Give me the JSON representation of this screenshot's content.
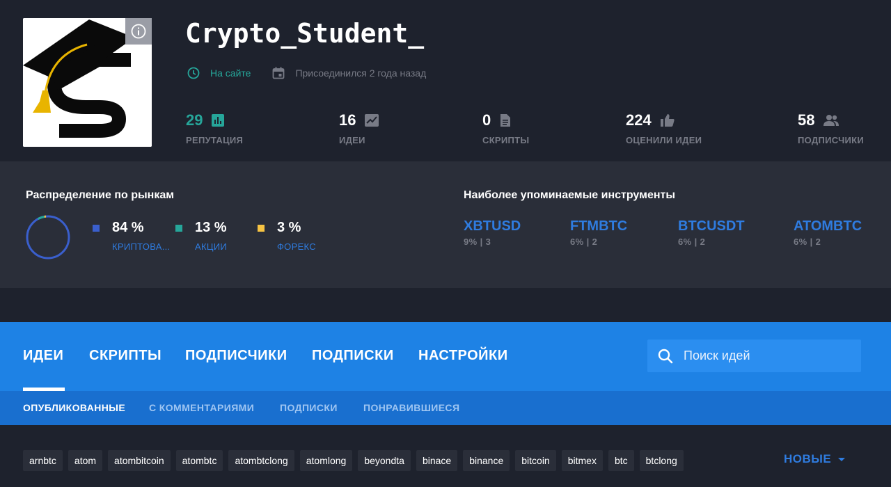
{
  "profile": {
    "username": "Crypto_Student_",
    "status": "На сайте",
    "joined": "Присоединился 2 года назад"
  },
  "stats": [
    {
      "value": "29",
      "label": "РЕПУТАЦИЯ",
      "icon": "reputation-chart-icon"
    },
    {
      "value": "16",
      "label": "ИДЕИ",
      "icon": "ideas-chart-icon"
    },
    {
      "value": "0",
      "label": "СКРИПТЫ",
      "icon": "script-document-icon"
    },
    {
      "value": "224",
      "label": "ОЦЕНИЛИ ИДЕИ",
      "icon": "thumbs-up-icon"
    },
    {
      "value": "58",
      "label": "ПОДПИСЧИКИ",
      "icon": "followers-icon"
    }
  ],
  "distribution": {
    "title": "Распределение по рынкам",
    "markets": [
      {
        "pct": "84 %",
        "name": "КРИПТОВА...",
        "color": "#3a5fcd",
        "share": 84
      },
      {
        "pct": "13 %",
        "name": "АКЦИИ",
        "color": "#26a69a",
        "share": 13
      },
      {
        "pct": "3 %",
        "name": "ФОРЕКС",
        "color": "#f6c343",
        "share": 3
      }
    ]
  },
  "instruments": {
    "title": "Наиболее упоминаемые инструменты",
    "items": [
      {
        "symbol": "XBTUSD",
        "sub": "9% | 3"
      },
      {
        "symbol": "FTMBTC",
        "sub": "6% | 2"
      },
      {
        "symbol": "BTCUSDT",
        "sub": "6% | 2"
      },
      {
        "symbol": "ATOMBTC",
        "sub": "6% | 2"
      }
    ]
  },
  "nav": {
    "tabs": [
      "ИДЕИ",
      "СКРИПТЫ",
      "ПОДПИСЧИКИ",
      "ПОДПИСКИ",
      "НАСТРОЙКИ"
    ],
    "active_tab": "ИДЕИ",
    "search_placeholder": "Поиск идей"
  },
  "subnav": {
    "items": [
      "ОПУБЛИКОВАННЫЕ",
      "С КОММЕНТАРИЯМИ",
      "ПОДПИСКИ",
      "ПОНРАВИВШИЕСЯ"
    ],
    "active": "ОПУБЛИКОВАННЫЕ"
  },
  "tags": [
    "arnbtc",
    "atom",
    "atombitcoin",
    "atombtc",
    "atombtclong",
    "atomlong",
    "beyondta",
    "binace",
    "binance",
    "bitcoin",
    "bitmex",
    "btc",
    "btclong"
  ],
  "sort": {
    "label": "НОВЫЕ"
  },
  "colors": {
    "background": "#1e222d",
    "panel": "#2a2e39",
    "nav_blue": "#1e82e5",
    "subnav_blue": "#196fcf",
    "link_blue": "#2f7ce0",
    "online_green": "#26a69a"
  }
}
